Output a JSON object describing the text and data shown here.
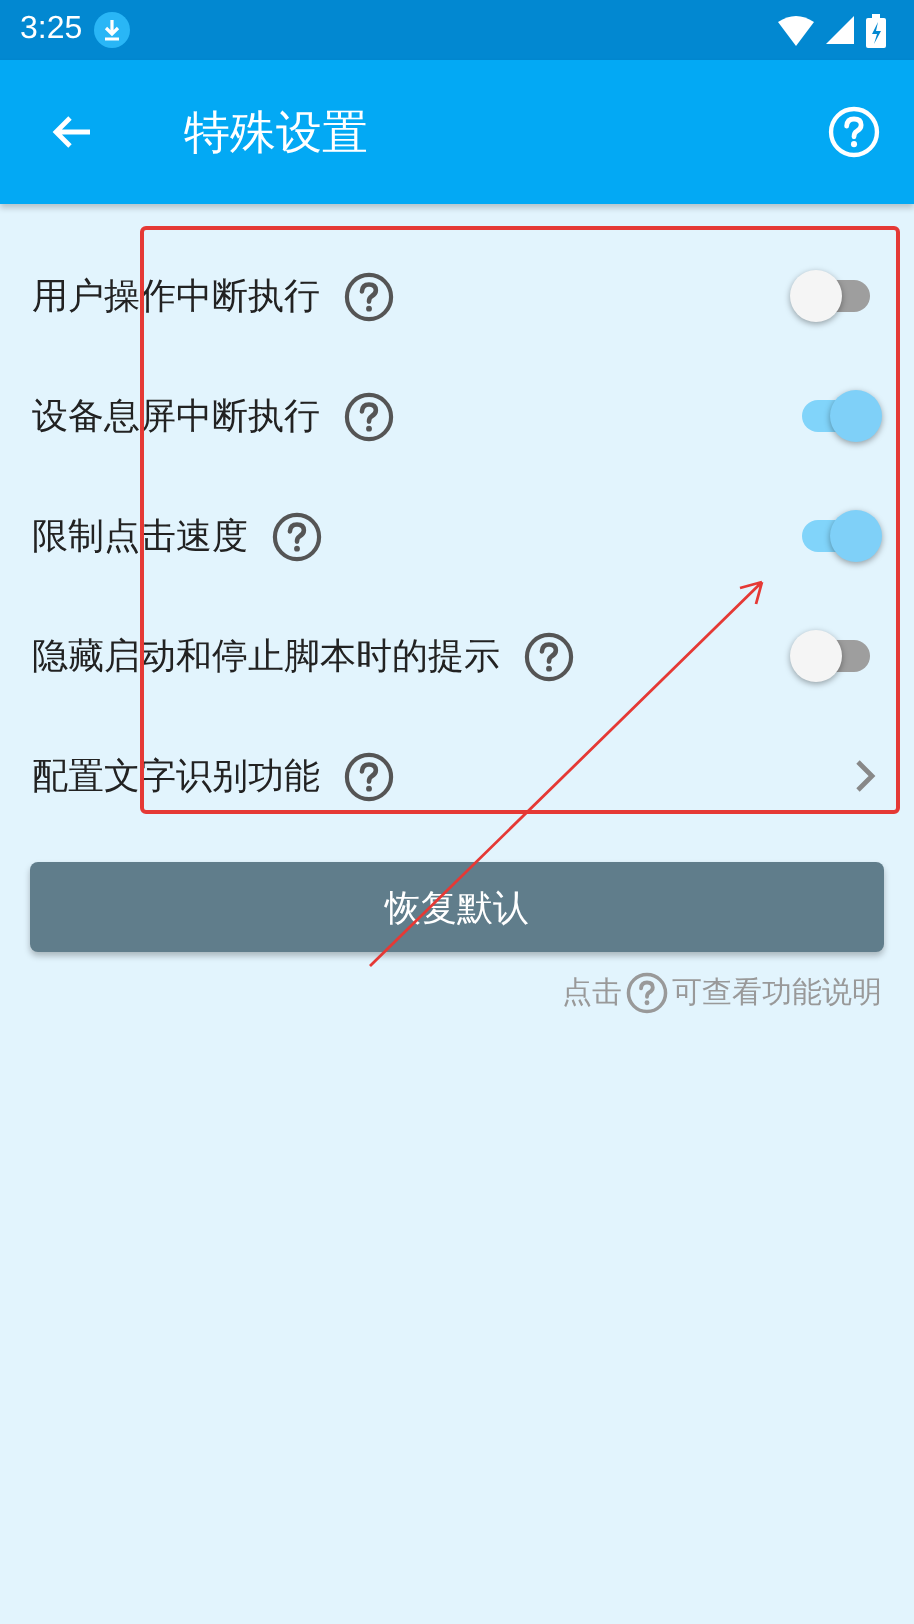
{
  "status_bar": {
    "time": "3:25"
  },
  "app_bar": {
    "title": "特殊设置"
  },
  "settings": [
    {
      "kind": "toggle",
      "label": "用户操作中断执行",
      "on": false
    },
    {
      "kind": "toggle",
      "label": "设备息屏中断执行",
      "on": true
    },
    {
      "kind": "toggle",
      "label": "限制点击速度",
      "on": true
    },
    {
      "kind": "toggle",
      "label": "隐藏启动和停止脚本时的提示",
      "on": false
    },
    {
      "kind": "link",
      "label": "配置文字识别功能"
    }
  ],
  "reset_button": "恢复默认",
  "hint": {
    "before": "点击",
    "after": "可查看功能说明"
  },
  "annotation": {
    "kind": "box_and_arrow"
  }
}
